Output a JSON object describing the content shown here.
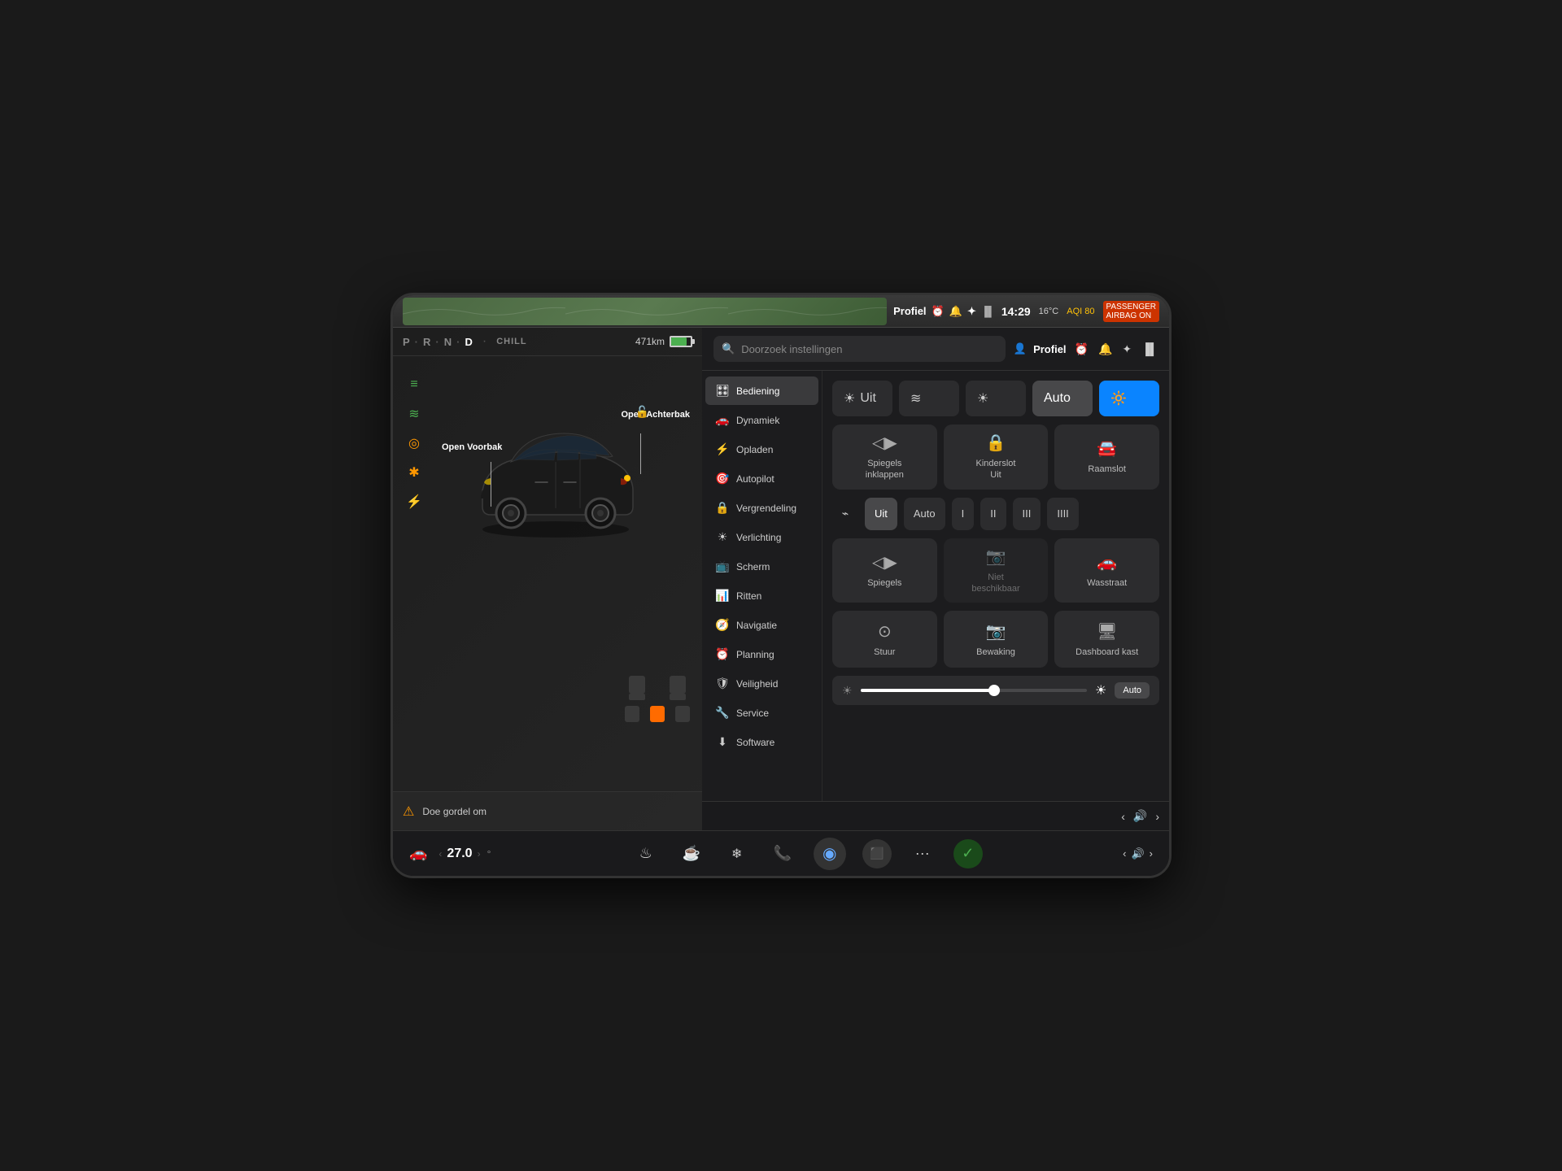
{
  "statusBar": {
    "profile": "Profiel",
    "time": "14:29",
    "temperature": "16°C",
    "aqi": "AQI 80",
    "lte": "LTE"
  },
  "leftPanel": {
    "prnd": [
      "P",
      "R",
      "N",
      "D"
    ],
    "activeGear": "D",
    "driveMode": "CHILL",
    "range": "471km",
    "icons": [
      {
        "symbol": "≡",
        "color": "green",
        "label": "beam-icon"
      },
      {
        "symbol": "≋",
        "color": "green",
        "label": "high-beam-icon"
      },
      {
        "symbol": "◎",
        "color": "orange",
        "label": "tpms-icon"
      },
      {
        "symbol": "✱",
        "color": "orange",
        "label": "service-icon"
      },
      {
        "symbol": "⚡",
        "color": "yellow",
        "label": "charge-icon"
      }
    ],
    "labelVoorbak": "Open\nVoorbak",
    "labelAchterbak": "Open\nAchterbak",
    "warningText": "Doe gordel om"
  },
  "rightPanel": {
    "searchPlaceholder": "Doorzoek instellingen",
    "profileLabel": "Profiel",
    "navItems": [
      {
        "label": "Bediening",
        "icon": "🎛",
        "active": true
      },
      {
        "label": "Dynamiek",
        "icon": "🚗"
      },
      {
        "label": "Opladen",
        "icon": "⚡"
      },
      {
        "label": "Autopilot",
        "icon": "🎯"
      },
      {
        "label": "Vergrendeling",
        "icon": "🔒"
      },
      {
        "label": "Verlichting",
        "icon": "☀"
      },
      {
        "label": "Scherm",
        "icon": "📺"
      },
      {
        "label": "Ritten",
        "icon": "📊"
      },
      {
        "label": "Navigatie",
        "icon": "🧭"
      },
      {
        "label": "Planning",
        "icon": "⏰"
      },
      {
        "label": "Veiligheid",
        "icon": "🛡"
      },
      {
        "label": "Service",
        "icon": "🔧"
      },
      {
        "label": "Software",
        "icon": "⬇"
      }
    ],
    "lightButtons": [
      {
        "label": "Uit",
        "icon": "☀",
        "active": false
      },
      {
        "label": "",
        "icon": "≋",
        "active": false
      },
      {
        "label": "",
        "icon": "☀",
        "active": false
      },
      {
        "label": "Auto",
        "active": false
      },
      {
        "label": "",
        "icon": "🔆",
        "active": true,
        "color": "blue"
      }
    ],
    "gridButtons": [
      {
        "label": "Spiegels\ninklappen",
        "icon": "◁▷"
      },
      {
        "label": "Kinderslot\nUit",
        "icon": "🔒"
      },
      {
        "label": "Raamslot",
        "icon": "🚗"
      }
    ],
    "wiperButtons": [
      {
        "label": "Uit",
        "active": true
      },
      {
        "label": "Auto",
        "active": false
      },
      {
        "label": "I",
        "active": false
      },
      {
        "label": "II",
        "active": false
      },
      {
        "label": "III",
        "active": false
      },
      {
        "label": "IIII",
        "active": false
      }
    ],
    "mirrorButtons": [
      {
        "label": "Spiegels",
        "icon": "◁▷"
      },
      {
        "label": "Niet\nbeschikbaar",
        "icon": "📷",
        "disabled": true
      },
      {
        "label": "Wasstraat",
        "icon": "🚗"
      }
    ],
    "bottomButtons": [
      {
        "label": "Stuur",
        "icon": "🎡"
      },
      {
        "label": "Bewaking",
        "icon": "📷"
      },
      {
        "label": "Dashboard kast",
        "icon": "📦"
      }
    ],
    "autoLabel": "Auto"
  },
  "taskbar": {
    "tempArrowLeft": "‹",
    "temperature": "27.0",
    "tempArrowRight": "›",
    "icons": [
      {
        "symbol": "♨",
        "name": "heat-icon"
      },
      {
        "symbol": "☕",
        "name": "cup-icon"
      },
      {
        "symbol": "❄",
        "name": "fan-icon"
      },
      {
        "symbol": "📞",
        "name": "phone-icon"
      },
      {
        "symbol": "◉",
        "name": "mic-icon"
      },
      {
        "symbol": "⬛",
        "name": "apps-icon"
      },
      {
        "symbol": "···",
        "name": "more-icon"
      },
      {
        "symbol": "✓",
        "name": "check-icon"
      }
    ],
    "volumeLeft": "‹",
    "volumeIcon": "🔊",
    "volumeRight": "›"
  }
}
